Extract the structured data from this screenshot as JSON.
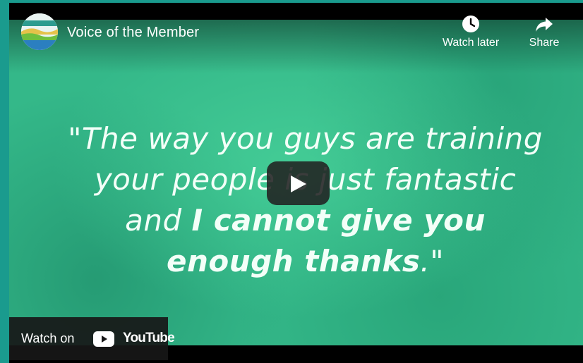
{
  "video": {
    "title": "Voice of the Member"
  },
  "actions": {
    "watch_later": "Watch later",
    "share": "Share"
  },
  "quote": {
    "line1": "\"The way you guys are training",
    "line2": "your people is just fantastic",
    "line3_normal": "and ",
    "line3_bold": "I cannot give you",
    "line4_bold": "enough thanks",
    "line4_end": ".\""
  },
  "footer": {
    "watch_on": "Watch on",
    "brand": "YouTube"
  },
  "colors": {
    "page_border": "#1a9b8e",
    "video_background": "#34b889",
    "youtube_red": "#ff0000"
  }
}
